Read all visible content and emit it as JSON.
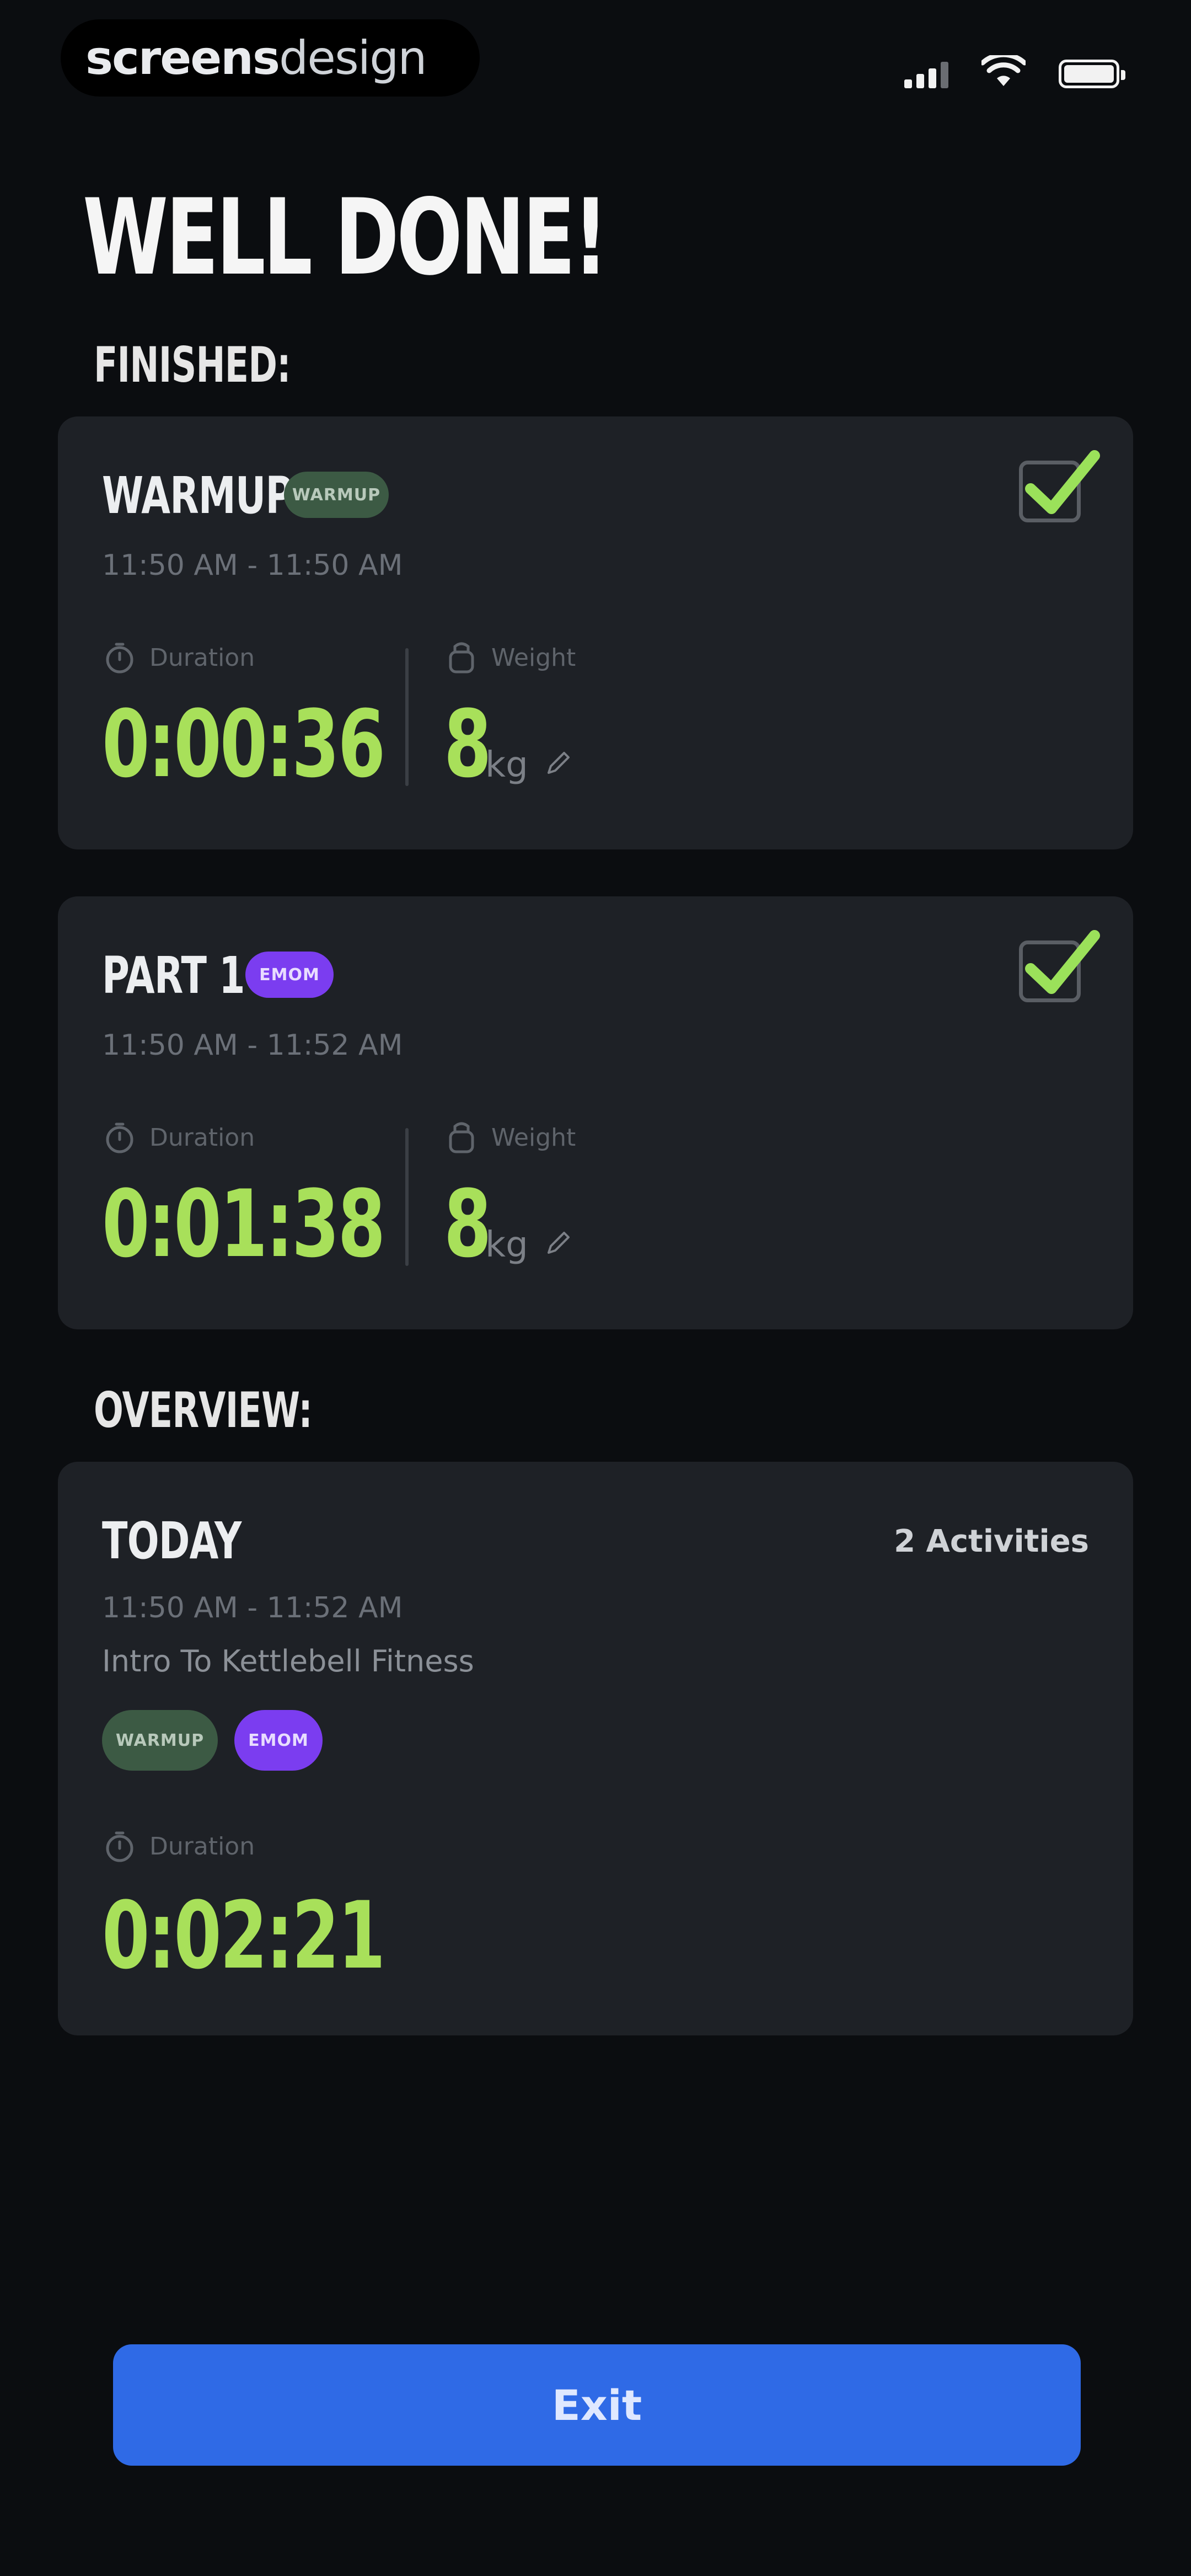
{
  "status_bar": {
    "brand_bold": "screens",
    "brand_light": "design"
  },
  "page": {
    "title": "WELL DONE!",
    "finished_label": "FINISHED:",
    "overview_label": "OVERVIEW:"
  },
  "activities": [
    {
      "title": "WARMUP",
      "tag": "WARMUP",
      "tag_color": "#3c5a44",
      "time_range": "11:50 AM - 11:50 AM",
      "completed": true,
      "duration_label": "Duration",
      "duration": "0:00:36",
      "weight_label": "Weight",
      "weight": "8",
      "weight_unit": "kg"
    },
    {
      "title": "PART 1",
      "tag": "EMOM",
      "tag_color": "#7b3df0",
      "time_range": "11:50 AM - 11:52 AM",
      "completed": true,
      "duration_label": "Duration",
      "duration": "0:01:38",
      "weight_label": "Weight",
      "weight": "8",
      "weight_unit": "kg"
    }
  ],
  "overview": {
    "title": "TODAY",
    "activities_count": "2 Activities",
    "time_range": "11:50 AM - 11:52 AM",
    "program": "Intro To Kettlebell Fitness",
    "tags": [
      "WARMUP",
      "EMOM"
    ],
    "duration_label": "Duration",
    "duration": "0:02:21"
  },
  "footer": {
    "exit_label": "Exit"
  },
  "colors": {
    "background": "#0b0d10",
    "card": "#1e2126",
    "accent_green": "#a8e05a",
    "button_blue": "#2f6ae6",
    "check_green": "#9be15a"
  }
}
